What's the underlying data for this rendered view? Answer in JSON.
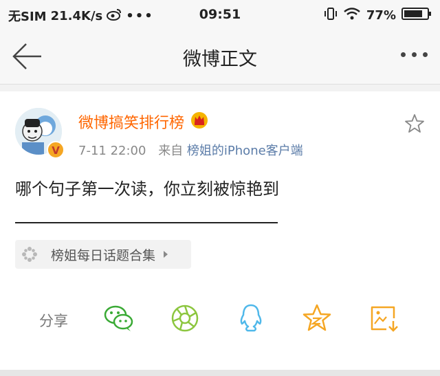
{
  "status_bar": {
    "carrier": "无SIM",
    "speed": "21.4K/s",
    "dots": "•••",
    "time": "09:51",
    "battery": "77%"
  },
  "nav": {
    "title": "微博正文"
  },
  "post": {
    "author": "微博搞笑排行榜",
    "date": "7-11 22:00",
    "from_label": "来自",
    "source": "榜姐的iPhone客户端",
    "text": "哪个句子第一次读，你立刻被惊艳到",
    "topic": "榜姐每日话题合集"
  },
  "share": {
    "label": "分享"
  },
  "colors": {
    "author": "#ff6600",
    "source": "#5b7ca8",
    "wechat": "#3aaa35",
    "moments": "#8cc63f",
    "qq": "#4fb8ea",
    "favorite": "#f5a623",
    "save": "#f5a623"
  }
}
